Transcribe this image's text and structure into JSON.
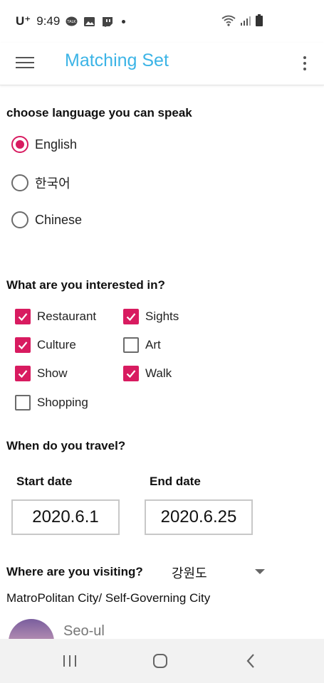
{
  "status_bar": {
    "carrier": "U⁺",
    "time": "9:49"
  },
  "app_bar": {
    "title": "Matching Set"
  },
  "language": {
    "title": "choose language you can speak",
    "options": [
      {
        "label": "English",
        "checked": true
      },
      {
        "label": "한국어",
        "checked": false
      },
      {
        "label": "Chinese",
        "checked": false
      }
    ]
  },
  "interests": {
    "title": "What are you interested in?",
    "options": [
      {
        "label": "Restaurant",
        "checked": true
      },
      {
        "label": "Sights",
        "checked": true
      },
      {
        "label": "Culture",
        "checked": true
      },
      {
        "label": "Art",
        "checked": false
      },
      {
        "label": "Show",
        "checked": true
      },
      {
        "label": "Walk",
        "checked": true
      },
      {
        "label": "Shopping",
        "checked": false
      }
    ]
  },
  "travel": {
    "title": "When do you travel?",
    "start_label": "Start date",
    "start_value": "2020.6.1",
    "end_label": "End date",
    "end_value": "2020.6.25"
  },
  "visiting": {
    "title": "Where are you visiting?",
    "selected_region": "강원도",
    "city_type": "MatroPolitan City/ Self-Governing City",
    "cities": [
      {
        "name": "Seo-ul"
      }
    ]
  },
  "colors": {
    "accent": "#d81b60",
    "title": "#3cb4e6"
  }
}
